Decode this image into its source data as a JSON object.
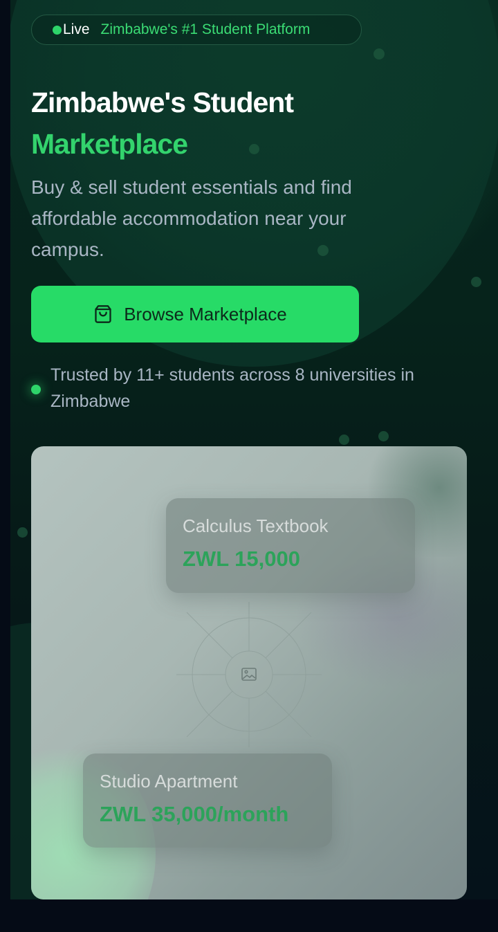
{
  "badge": {
    "live_label": "Live",
    "text": "Zimbabwe's #1 Student Platform"
  },
  "hero": {
    "title_line1": "Zimbabwe's Student",
    "title_line2": "Marketplace",
    "subtitle": "Buy & sell student essentials and find affordable accommodation near your campus.",
    "cta_label": "Browse Marketplace",
    "cta_icon": "shopping-bag-icon",
    "trust_text": "Trusted by 11+ students across 8 universities in Zimbabwe"
  },
  "showcase": {
    "center_icon": "image-icon",
    "cards": [
      {
        "name": "Calculus Textbook",
        "price": "ZWL 15,000"
      },
      {
        "name": "Studio Apartment",
        "price": "ZWL 35,000/month"
      }
    ]
  },
  "colors": {
    "accent_green": "#27db67",
    "background": "#050b16",
    "hero_background": "#07241d",
    "muted_text": "#a9b6c4"
  }
}
